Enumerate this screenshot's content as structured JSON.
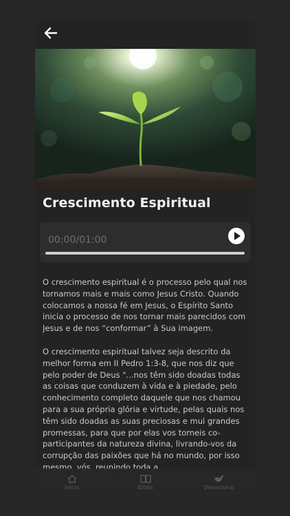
{
  "header": {
    "back_icon": "arrow-left-icon"
  },
  "hero": {
    "image": "seedling-photo"
  },
  "devotional": {
    "title": "Crescimento Espiritual",
    "paragraphs": [
      "O crescimento espiritual é o processo pelo qual nos tornamos mais e mais como Jesus Cristo. Quando colocamos a nossa fé em Jesus, o Espírito Santo inicia o processo de nos tornar mais parecidos com Jesus e de nos “conformar” à Sua imagem.",
      "O crescimento espiritual talvez seja descrito da melhor forma em II Pedro 1:3-8, que nos diz que pelo poder de Deus \"...nos têm sido doadas todas as coisas que conduzem à vida e à piedade, pelo conhecimento completo daquele que nos chamou para a sua própria glória e virtude, pelas quais nos têm sido doadas as suas preciosas e mui grandes promessas, para que por elas vos torneis co-participantes da natureza divina, livrando-vos da corrupção das paixões que há no mundo, por isso mesmo, vós, reunindo toda a"
    ]
  },
  "player": {
    "time": "00:00/01:00",
    "progress": 0,
    "play_icon": "play-icon"
  },
  "nav": {
    "items": [
      {
        "label": "Início",
        "icon": "home-icon"
      },
      {
        "label": "Bíblia",
        "icon": "book-icon"
      },
      {
        "label": "Devocional",
        "icon": "dove-icon"
      }
    ]
  },
  "colors": {
    "background": "#262626",
    "card": "#232323",
    "player_bg": "#2d2d2d",
    "text": "#cacaca",
    "title": "#f2f2f2"
  }
}
